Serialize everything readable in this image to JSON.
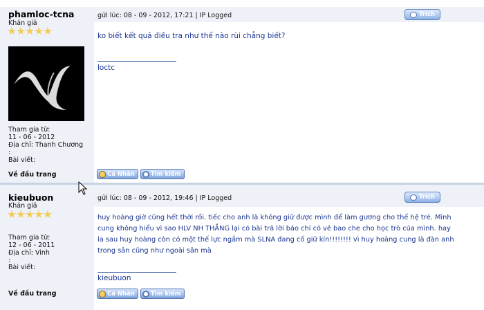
{
  "posts": [
    {
      "username": "phamloc-tcna",
      "rank": "Khán giả",
      "stars": 5,
      "member_since_label": "Tham gia từ:",
      "member_since": "11 - 06 - 2012",
      "address": "Địa chỉ: Thanh Chương",
      "address_extra": ":",
      "posts_label": "Bài viết:",
      "header": "gửi lúc: 08 - 09 - 2012, 17:21 | IP Logged",
      "quote_label": "Trích",
      "lines": [
        "ko biết kết quả điều tra như thế nào rùi chẳng biết?"
      ],
      "signature": "loctc",
      "back_to_top": "Về đầu trang",
      "profile_button": "Cá Nhân",
      "search_button": "Tìm kiếm"
    },
    {
      "username": "kieubuon",
      "rank": "Khán giả",
      "stars": 5,
      "member_since_label": "Tham gia từ:",
      "member_since": "12 - 06 - 2011",
      "address": "Địa chỉ: Vinh",
      "address_extra": ":",
      "posts_label": "Bài viết:",
      "header": "gửi lúc: 08 - 09 - 2012, 19:46 | IP Logged",
      "quote_label": "Trích",
      "lines": [
        "huy hoàng giờ cũng hết thời rồi. tiếc cho anh là không giữ được mình để làm gương cho thế hệ trẻ. Mình",
        "cung không hiểu vì sao HLV NH THẮNG lại có bài trả lời báo chí có vẻ bao che cho học trò của mình. hay",
        "la sau huy hoàng còn có một thế lực ngầm mà SLNA đang cố giữ kín!!!!!!!! vì huy hoàng cung là đàn anh",
        "trong sân cũng như ngoài sân mà"
      ],
      "signature": "kieubuon",
      "back_to_top": "Về đầu trang",
      "profile_button": "Cá Nhân",
      "search_button": "Tìm kiếm"
    }
  ]
}
